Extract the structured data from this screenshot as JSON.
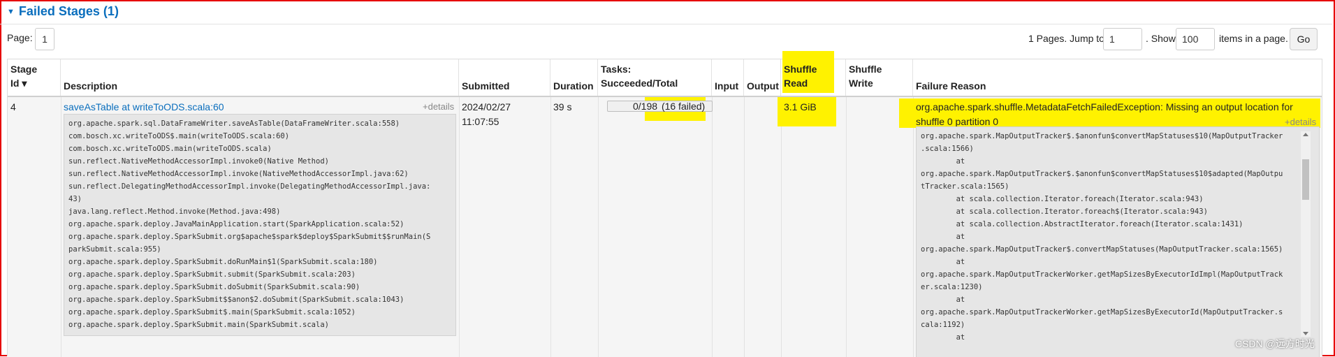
{
  "section": {
    "title": "Failed Stages (1)"
  },
  "pagination": {
    "page_label": "Page:",
    "page_value": "1",
    "pages_text": "1 Pages. Jump to",
    "jump_value": "1",
    "show_text": ". Show",
    "show_value": "100",
    "items_text": "items in a page.",
    "go_label": "Go"
  },
  "table": {
    "headers": {
      "stage_id": [
        "Stage",
        "Id ▾"
      ],
      "description": "Description",
      "submitted": "Submitted",
      "duration": "Duration",
      "tasks": [
        "Tasks:",
        "Succeeded/Total"
      ],
      "input": "Input",
      "output": "Output",
      "shuffle_read": [
        "Shuffle",
        "Read"
      ],
      "shuffle_write": [
        "Shuffle",
        "Write"
      ],
      "failure_reason": "Failure Reason"
    },
    "row": {
      "stage_id": "4",
      "description_link": "saveAsTable at writeToODS.scala:60",
      "details_label": "+details",
      "description_stack": [
        "org.apache.spark.sql.DataFrameWriter.saveAsTable(DataFrameWriter.scala:558)",
        "com.bosch.xc.writeToODS$.main(writeToODS.scala:60)",
        "com.bosch.xc.writeToODS.main(writeToODS.scala)",
        "sun.reflect.NativeMethodAccessorImpl.invoke0(Native Method)",
        "sun.reflect.NativeMethodAccessorImpl.invoke(NativeMethodAccessorImpl.java:62)",
        "sun.reflect.DelegatingMethodAccessorImpl.invoke(DelegatingMethodAccessorImpl.java:",
        "43)",
        "java.lang.reflect.Method.invoke(Method.java:498)",
        "org.apache.spark.deploy.JavaMainApplication.start(SparkApplication.scala:52)",
        "org.apache.spark.deploy.SparkSubmit.org$apache$spark$deploy$SparkSubmit$$runMain(S",
        "parkSubmit.scala:955)",
        "org.apache.spark.deploy.SparkSubmit.doRunMain$1(SparkSubmit.scala:180)",
        "org.apache.spark.deploy.SparkSubmit.submit(SparkSubmit.scala:203)",
        "org.apache.spark.deploy.SparkSubmit.doSubmit(SparkSubmit.scala:90)",
        "org.apache.spark.deploy.SparkSubmit$$anon$2.doSubmit(SparkSubmit.scala:1043)",
        "org.apache.spark.deploy.SparkSubmit$.main(SparkSubmit.scala:1052)",
        "org.apache.spark.deploy.SparkSubmit.main(SparkSubmit.scala)"
      ],
      "submitted_date": "2024/02/27",
      "submitted_time": "11:07:55",
      "duration": "39 s",
      "tasks_progress": "0/198",
      "tasks_failed": "(16 failed)",
      "tasks_succeeded_fraction": 0,
      "input": "",
      "output": "",
      "shuffle_read": "3.1 GiB",
      "shuffle_write": "",
      "failure_reason_line1": "org.apache.spark.shuffle.MetadataFetchFailedException: Missing an output location for",
      "failure_reason_line2": "shuffle 0 partition 0",
      "failure_details_label": "+details",
      "failure_stack": [
        "org.apache.spark.MapOutputTracker$.$anonfun$convertMapStatuses$10(MapOutputTracker",
        ".scala:1566)",
        "        at",
        "org.apache.spark.MapOutputTracker$.$anonfun$convertMapStatuses$10$adapted(MapOutpu",
        "tTracker.scala:1565)",
        "        at scala.collection.Iterator.foreach(Iterator.scala:943)",
        "        at scala.collection.Iterator.foreach$(Iterator.scala:943)",
        "        at scala.collection.AbstractIterator.foreach(Iterator.scala:1431)",
        "        at",
        "org.apache.spark.MapOutputTracker$.convertMapStatuses(MapOutputTracker.scala:1565)",
        "        at",
        "org.apache.spark.MapOutputTrackerWorker.getMapSizesByExecutorIdImpl(MapOutputTrack",
        "er.scala:1230)",
        "        at",
        "org.apache.spark.MapOutputTrackerWorker.getMapSizesByExecutorId(MapOutputTracker.s",
        "cala:1192)",
        "        at"
      ]
    }
  },
  "watermark": "CSDN @远方时光",
  "colors": {
    "link": "#0a6ebd",
    "highlight": "#fff200",
    "border": "#e60000"
  }
}
